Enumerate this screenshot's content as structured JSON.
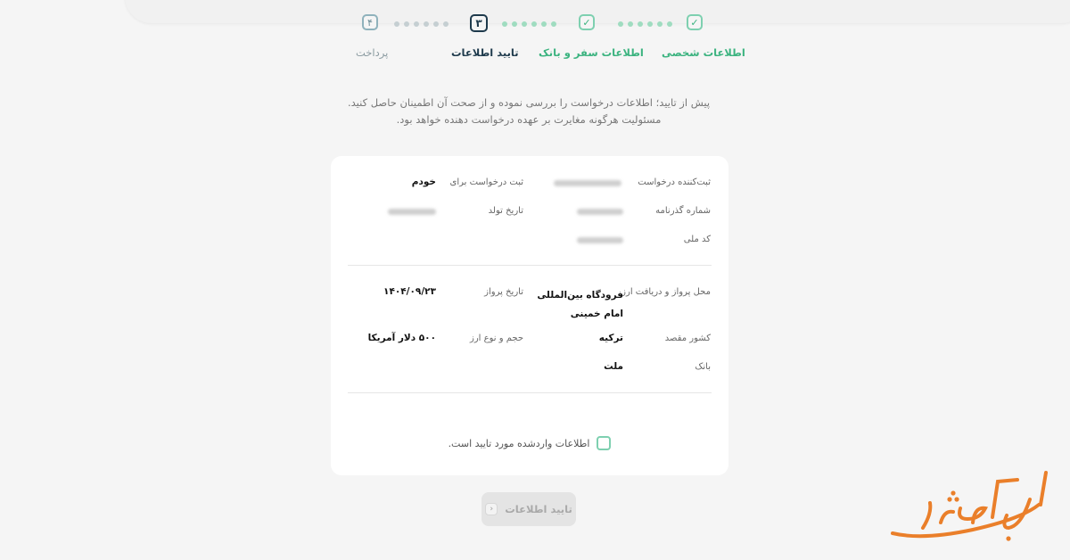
{
  "stepper": {
    "steps": [
      {
        "label": "اطلاعات شخصی",
        "mark": "✓"
      },
      {
        "label": "اطلاعات سفر و بانک",
        "mark": "✓"
      },
      {
        "label": "تایید اطلاعات",
        "mark": "۳"
      },
      {
        "label": "پرداخت",
        "mark": "۴"
      }
    ]
  },
  "intro": "پیش از تایید؛ اطلاعات درخواست را بررسی نموده و از صحت آن اطمینان حاصل کنید. مسئولیت هرگونه مغایرت بر عهده درخواست دهنده خواهد بود.",
  "personal": {
    "registrant_label": "ثبت‌کننده درخواست",
    "register_for_label": "ثبت درخواست برای",
    "register_for_value": "خودم",
    "passport_label": "شماره گذرنامه",
    "birth_label": "تاریخ تولد",
    "national_id_label": "کد ملی"
  },
  "travel": {
    "location_label": "محل پرواز و دریافت ارز",
    "location_value": "فرودگاه بین‌المللی امام خمینی",
    "flight_date_label": "تاریخ پرواز",
    "flight_date_value": "۱۴۰۴/۰۹/۲۳",
    "country_label": "کشور مقصد",
    "country_value": "ترکیه",
    "currency_label": "حجم و نوع ارز",
    "currency_value": "۵۰۰ دلار آمریکا",
    "bank_label": "بانک",
    "bank_value": "ملت"
  },
  "confirm_text": "اطلاعات واردشده مورد تایید است.",
  "submit_label": "تایید اطلاعات",
  "logo_text": "الی گشت",
  "colors": {
    "brand_green": "#3bb37f",
    "dark": "#1e3a4c",
    "logo_orange": "#ea7f2a"
  }
}
